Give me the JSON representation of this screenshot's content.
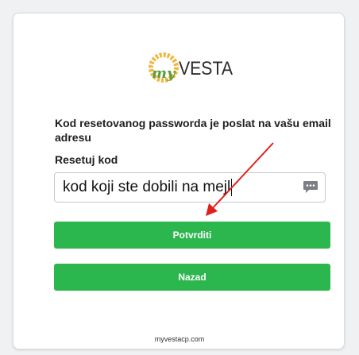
{
  "brand": {
    "logo_prefix": "my",
    "logo_name": "VESTA",
    "accent_orange": "#f5a623",
    "accent_green": "#6aa84f"
  },
  "form": {
    "message": "Kod resetovanog passworda je poslat na vašu email adresu",
    "field_label": "Resetuj kod",
    "code_input_value": "kod koji ste dobili na mejl",
    "confirm_label": "Potvrditi",
    "back_label": "Nazad"
  },
  "footer": {
    "link_text": "myvestacp.com"
  },
  "icons": {
    "input_side_icon": "chat-bubble-icon",
    "annotation": "red-arrow-icon"
  },
  "colors": {
    "button_green": "#2cb64e",
    "annotation_red": "#e0201c"
  }
}
